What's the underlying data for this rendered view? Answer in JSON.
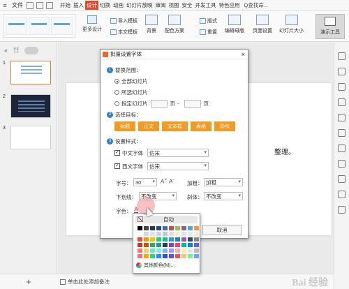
{
  "menu": {
    "file": "文件",
    "tabs": [
      "开始",
      "插入",
      "设计",
      "切换",
      "动画",
      "幻灯片放映",
      "审阅",
      "视图",
      "安全",
      "开发工具",
      "特色应用"
    ],
    "active_tab": "设计",
    "search": "Q查找命..."
  },
  "ribbon": {
    "more_design": "更多设计",
    "import_template": "导入模板",
    "body_template": "本文模板",
    "background": "背景",
    "color_scheme": "配色方案",
    "layout": "版式",
    "rearrange": "重置",
    "edit_master": "编辑母版",
    "page_setup": "页面设置",
    "slide_size": "幻灯片大小",
    "present_tools": "演示工具"
  },
  "slides": [
    {
      "num": "1"
    },
    {
      "num": "2"
    },
    {
      "num": "3"
    }
  ],
  "canvas": {
    "text": "整理。"
  },
  "status": {
    "add_note": "单击此处添加备注",
    "watermark": "Bai 经验"
  },
  "dialog": {
    "title": "批量设置字体",
    "close": "×",
    "sec1": {
      "num": "1",
      "title": "替换范围："
    },
    "radio_all": "全部幻灯片",
    "radio_selected": "所选幻灯片",
    "radio_specified": "指定幻灯片",
    "page_unit": "页",
    "page_sep": "-",
    "sec2": {
      "num": "2",
      "title": "选择目标："
    },
    "targets": [
      "标题",
      "正文",
      "文本框",
      "表格",
      "形状"
    ],
    "sec3": {
      "num": "3",
      "title": "设置样式："
    },
    "cn_font_label": "中文字体",
    "cn_font_value": "仿宋",
    "west_font_label": "西文字体",
    "west_font_value": "仿宋",
    "size_label": "字号：",
    "size_value": "30",
    "bold_label": "加粗：",
    "bold_value": "加粗",
    "underline_label": "下划线：",
    "underline_value": "不改变",
    "italic_label": "斜体：",
    "italic_value": "不改变",
    "color_label": "字色：",
    "cancel": "取消"
  },
  "color_popup": {
    "auto": "自动",
    "more": "其他颜色(M)...",
    "swatches": [
      "#000000",
      "#444444",
      "#1f3864",
      "#2e4a7a",
      "#3f6ea8",
      "#c0504d",
      "#9bbb59",
      "#8064a2",
      "#4bacc6",
      "#f79646",
      "#ffffff",
      "#d9d9d9",
      "#dbe5f1",
      "#c6d9f0",
      "#b8cce4",
      "#f2dcdb",
      "#ebf1dd",
      "#e5e0ec",
      "#dbeef3",
      "#fdeada",
      "#e74c3c",
      "#f39c12",
      "#f1c40f",
      "#2ecc71",
      "#1abc9c",
      "#3498db",
      "#2980b9",
      "#9b59b6",
      "#34495e",
      "#7f8c8d",
      "#c0392b",
      "#d35400",
      "#27ae60",
      "#16a085",
      "#2c3e50",
      "#8e44ad",
      "#e84393",
      "#00b894",
      "#0984e3",
      "#6c5ce7",
      "#ff7675",
      "#fdcb6e",
      "#55efc4",
      "#81ecec",
      "#74b9ff",
      "#a29bfe",
      "#fab1a0",
      "#ffeaa7",
      "#dfe6e9",
      "#b2bec3",
      "#ff6b81",
      "#ffa502",
      "#2ed573",
      "#1e90ff",
      "#3742fa",
      "#5352ed",
      "#ff4757",
      "#eccc68",
      "#7bed9f",
      "#70a1ff"
    ]
  }
}
